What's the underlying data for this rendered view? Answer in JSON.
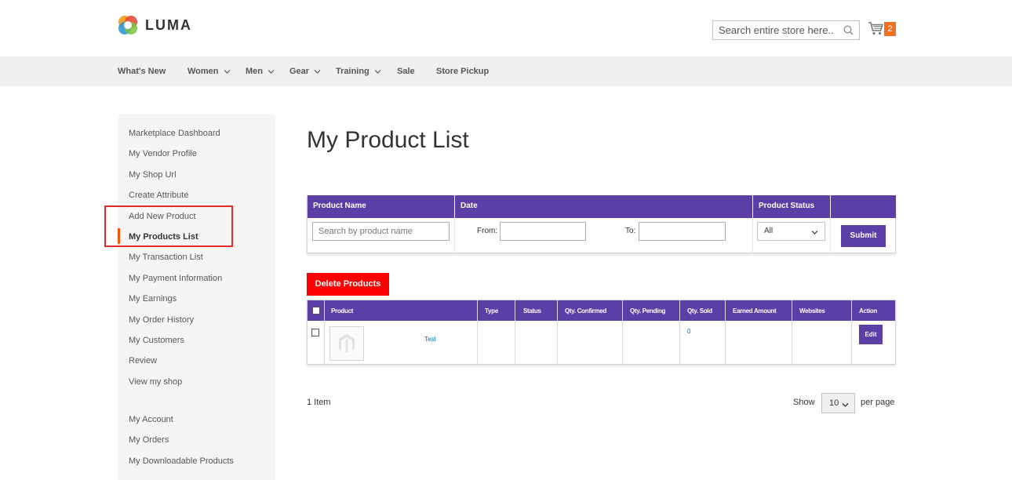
{
  "brand": {
    "name": "LUMA"
  },
  "header": {
    "search_placeholder": "Search entire store here..",
    "cart_count": "2"
  },
  "nav": {
    "items": [
      {
        "label": "What's New",
        "has_dropdown": false
      },
      {
        "label": "Women",
        "has_dropdown": true
      },
      {
        "label": "Men",
        "has_dropdown": true
      },
      {
        "label": "Gear",
        "has_dropdown": true
      },
      {
        "label": "Training",
        "has_dropdown": true
      },
      {
        "label": "Sale",
        "has_dropdown": false
      },
      {
        "label": "Store Pickup",
        "has_dropdown": false
      }
    ]
  },
  "sidebar": {
    "items": [
      "Marketplace Dashboard",
      "My Vendor Profile",
      "My Shop Url",
      "Create Attribute",
      "Add New Product",
      "My Products List",
      "My Transaction List",
      "My Payment Information",
      "My Earnings",
      "My Order History",
      "My Customers",
      "Review",
      "View my shop",
      "My Account",
      "My Orders",
      "My Downloadable Products"
    ],
    "active_item": "My Products List"
  },
  "main": {
    "title": "My Product List",
    "filter": {
      "headers": [
        "Product Name",
        "Date",
        "Product Status"
      ],
      "product_name_placeholder": "Search by product name",
      "from_label": "From:",
      "to_label": "To:",
      "status_value": "All",
      "submit_label": "Submit"
    },
    "delete_label": "Delete Products",
    "table": {
      "headers": [
        "Product",
        "Type",
        "Status",
        "Qty. Confirmed",
        "Qty. Pending",
        "Qty. Sold",
        "Earned Amount",
        "Websites",
        "Action"
      ],
      "rows": [
        {
          "name": "Test",
          "type": "",
          "status": "",
          "qty_confirmed": "",
          "qty_pending": "",
          "qty_sold": "0",
          "earned": "",
          "websites": "",
          "action": "Edit"
        }
      ]
    },
    "toolbar": {
      "count": "1 Item",
      "show_label": "Show",
      "limit_value": "10",
      "per_page_label": "per page"
    }
  },
  "colors": {
    "accent_purple": "#5b3ea6",
    "delete_red": "#ff0000",
    "cart_badge": "#f26f21",
    "highlight_red": "#e02b27"
  }
}
